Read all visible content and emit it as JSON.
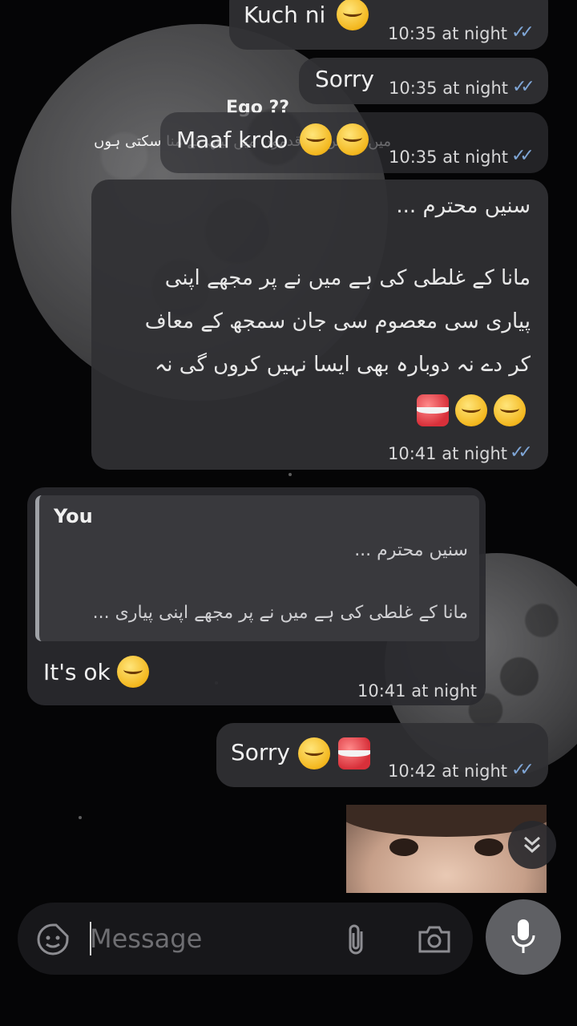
{
  "theme": {
    "accent": "#7fa6d6",
    "bubble_bg": "#2c2c30",
    "background": "#050506"
  },
  "messages": [
    {
      "text": "Kuch ni",
      "time": "10:35 at night"
    },
    {
      "text": "Sorry",
      "time": "10:35 at night"
    },
    {
      "text": "Maaf krdo",
      "time": "10:35 at night"
    },
    {
      "lines": [
        "سنیں محترم ...",
        "مانا کے غلطی کی ہے میں نے پر مجھے اپنی",
        "پیاری سی معصوم سی جان سمجھ کے معاف",
        "کر دے نہ دوبارہ بھی ایسا نہیں کروں گی نہ"
      ],
      "time": "10:41 at night"
    },
    {
      "reply_to": {
        "sender": "You",
        "line1": "سنیں محترم ...",
        "line2": "مانا کے غلطی کی ہے میں نے پر مجھے اپنی پیاری ..."
      },
      "text": "It's ok",
      "time": "10:41 at night"
    },
    {
      "text": "Sorry",
      "time": "10:42 at night"
    }
  ],
  "overlay": {
    "ego": "Ego ??",
    "urdu_line": "میں تو اس کے قدموں میں بیٹھ کے منا سکتی ہوں"
  },
  "read_ticks": "✓✓",
  "input": {
    "placeholder": "Message"
  },
  "icons": {
    "sticker": "sticker-icon",
    "attach": "paperclip-icon",
    "camera": "camera-icon",
    "mic": "microphone-icon",
    "scroll": "chevron-double-down-icon"
  }
}
